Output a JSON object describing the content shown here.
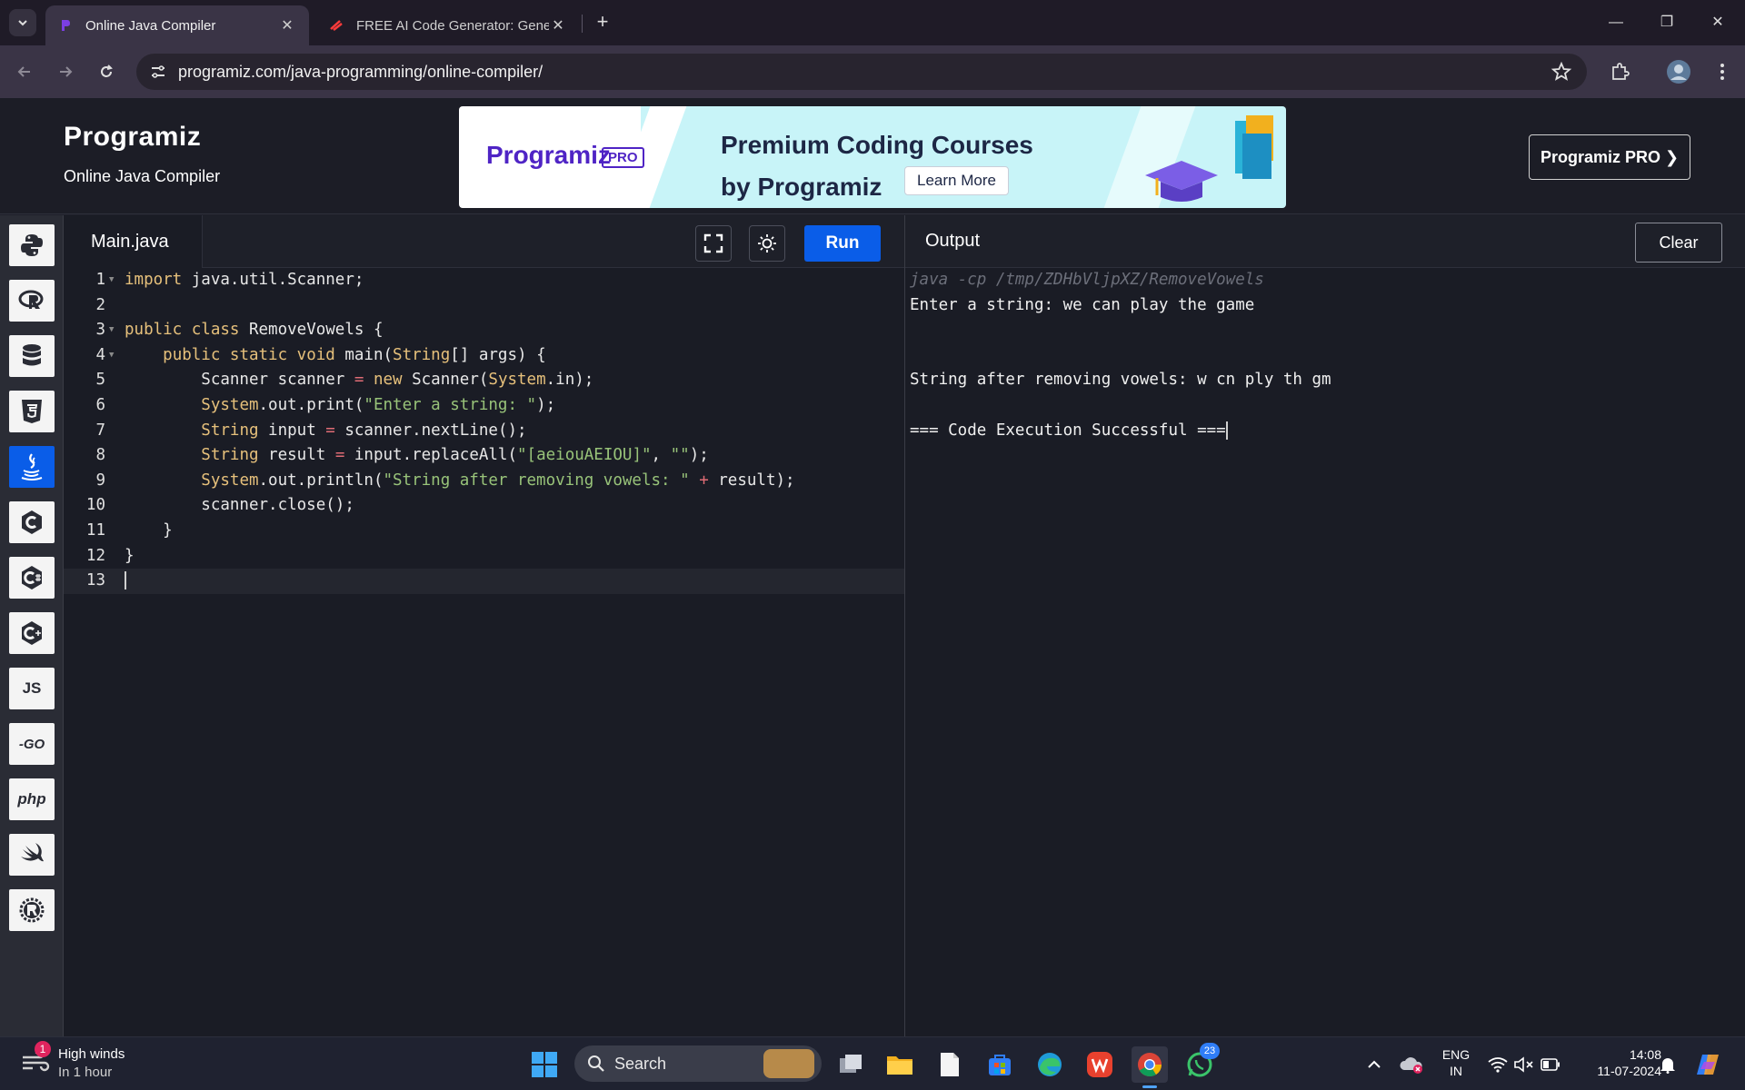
{
  "browser": {
    "tabs": [
      {
        "title": "Online Java Compiler",
        "active": true
      },
      {
        "title": "FREE AI Code Generator: Gener",
        "active": false
      }
    ],
    "url": "programiz.com/java-programming/online-compiler/"
  },
  "site": {
    "brand": "Programiz",
    "subtitle": "Online Java Compiler",
    "banner": {
      "logo": "Programiz",
      "badge": "PRO",
      "headline1": "Premium Coding Courses",
      "headline2": "by Programiz",
      "cta": "Learn More"
    },
    "pro_button": "Programiz PRO ❯"
  },
  "languages": [
    {
      "name": "python-icon",
      "label": ""
    },
    {
      "name": "r-icon",
      "label": ""
    },
    {
      "name": "sql-icon",
      "label": ""
    },
    {
      "name": "html5-icon",
      "label": ""
    },
    {
      "name": "java-icon",
      "label": "",
      "active": true
    },
    {
      "name": "c-icon",
      "label": ""
    },
    {
      "name": "csharp-icon",
      "label": ""
    },
    {
      "name": "cpp-icon",
      "label": ""
    },
    {
      "name": "js-icon",
      "label": "JS"
    },
    {
      "name": "go-icon",
      "label": "-GO"
    },
    {
      "name": "php-icon",
      "label": "php"
    },
    {
      "name": "swift-icon",
      "label": ""
    },
    {
      "name": "rust-icon",
      "label": ""
    }
  ],
  "editor": {
    "filename": "Main.java",
    "run_label": "Run",
    "lines": [
      "1",
      "2",
      "3",
      "4",
      "5",
      "6",
      "7",
      "8",
      "9",
      "10",
      "11",
      "12",
      "13"
    ]
  },
  "output": {
    "title": "Output",
    "clear_label": "Clear",
    "lines": [
      "java -cp /tmp/ZDHbVljpXZ/RemoveVowels",
      "Enter a string: we can play the game",
      "",
      "",
      "String after removing vowels: w cn ply th gm",
      "",
      "=== Code Execution Successful ==="
    ]
  },
  "taskbar": {
    "weather_title": "High winds",
    "weather_sub": "In 1 hour",
    "weather_badge": "1",
    "search_label": "Search",
    "whatsapp_badge": "23",
    "lang1": "ENG",
    "lang2": "IN",
    "time": "14:08",
    "date": "11-07-2024"
  },
  "colors": {
    "accent": "#0a5de8",
    "brand_purple": "#4f24c5"
  }
}
